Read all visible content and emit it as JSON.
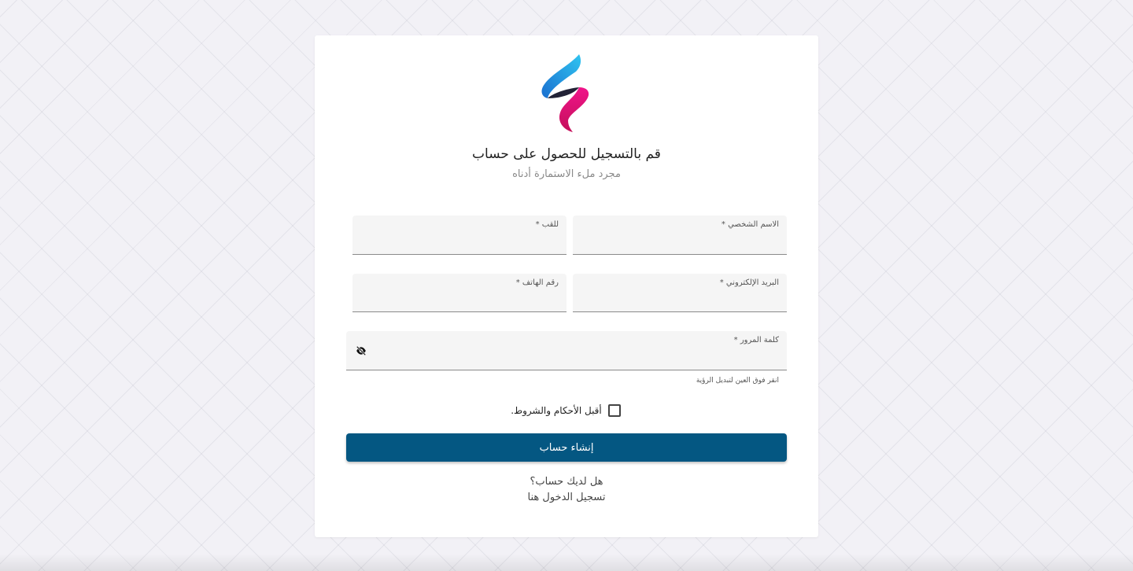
{
  "header": {
    "title": "قم بالتسجيل للحصول على حساب",
    "subtitle": "مجرد ملء الاستمارة أدناه"
  },
  "form": {
    "first_name_label": "الاسم الشخصي *",
    "last_name_label": "للقب *",
    "email_label": "البريد الإلكتروني *",
    "phone_label": "رقم الهاتف *",
    "password_label": "كلمة المرور *",
    "password_hint": "انقر فوق العين لتبديل الرؤية",
    "terms_label": "أقبل الأحكام والشروط.",
    "terms_checked": false,
    "submit_label": "إنشاء حساب"
  },
  "footer": {
    "have_account": "هل لديك حساب؟",
    "login_link": "تسجيل الدخول هنا"
  },
  "colors": {
    "primary": "#045782",
    "logo_blue": "#1c9be6",
    "logo_pink": "#e6157a",
    "logo_dark": "#222236"
  },
  "icons": {
    "password_toggle": "eye-off-icon",
    "logo": "brand-logo"
  }
}
